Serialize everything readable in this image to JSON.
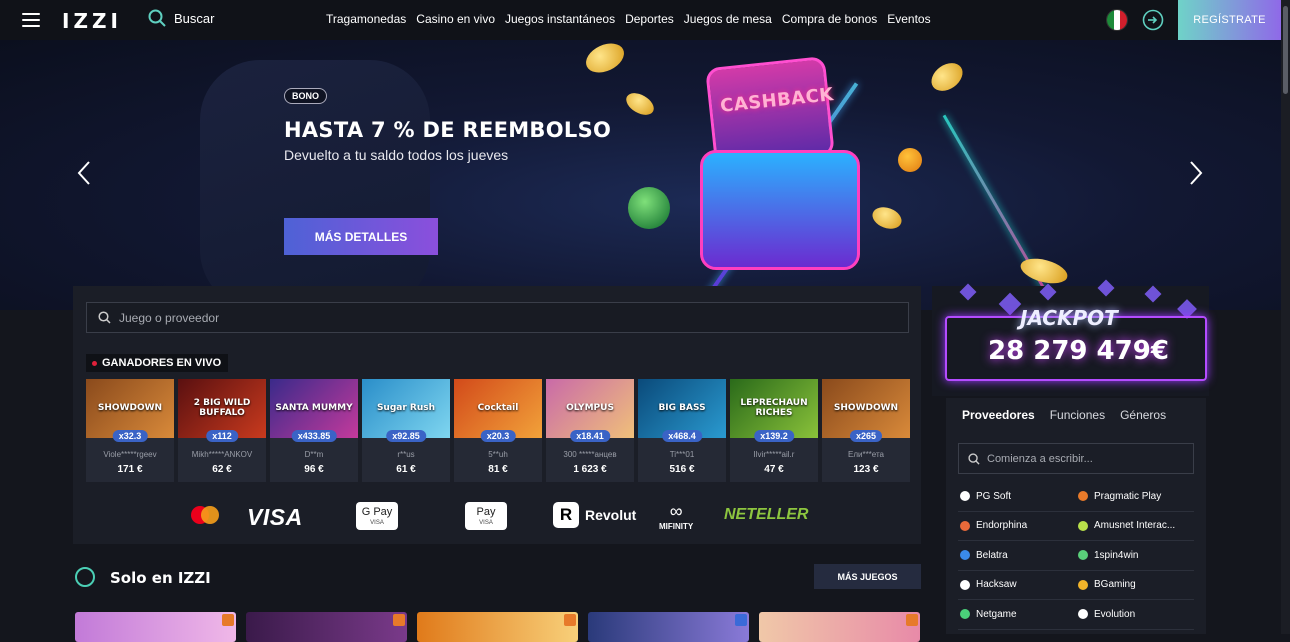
{
  "header": {
    "logo": "IZZI",
    "search_label": "Buscar",
    "nav": [
      "Tragamonedas",
      "Casino en vivo",
      "Juegos instantáneos",
      "Deportes",
      "Juegos de mesa",
      "Compra de bonos",
      "Eventos"
    ],
    "register_label": "REGÍSTRATE"
  },
  "hero": {
    "badge": "BONO",
    "title": "HASTA 7 % DE REEMBOLSO",
    "subtitle": "Devuelto a tu saldo todos los jueves",
    "button": "MÁS DETALLES",
    "art_text": "CASHBACK"
  },
  "game_search": {
    "placeholder": "Juego o proveedor"
  },
  "winners": {
    "label": "GANADORES EN VIVO",
    "items": [
      {
        "game": "SHOWDOWN",
        "multiplier": "x32.3",
        "user": "Viole*****rgeev",
        "amount": "171 €",
        "color1": "#8a4a1c",
        "color2": "#d98a3a"
      },
      {
        "game": "2 BIG WILD BUFFALO",
        "multiplier": "x112",
        "user": "Mikh*****ANKOV",
        "amount": "62 €",
        "color1": "#5a1010",
        "color2": "#c93a1e"
      },
      {
        "game": "SANTA MUMMY",
        "multiplier": "x433.85",
        "user": "D**m",
        "amount": "96 €",
        "color1": "#3a2a8a",
        "color2": "#c43a9c"
      },
      {
        "game": "Sugar Rush",
        "multiplier": "x92.85",
        "user": "r**us",
        "amount": "61 €",
        "color1": "#2a8ec9",
        "color2": "#7fd6f0"
      },
      {
        "game": "Cocktail",
        "multiplier": "x20.3",
        "user": "5**uh",
        "amount": "81 €",
        "color1": "#d24a1a",
        "color2": "#f2a23a"
      },
      {
        "game": "OLYMPUS",
        "multiplier": "x18.41",
        "user": "300 *****анцев",
        "amount": "1 623 €",
        "color1": "#c96aa8",
        "color2": "#f0c07a"
      },
      {
        "game": "BIG BASS",
        "multiplier": "x468.4",
        "user": "Ti***01",
        "amount": "516 €",
        "color1": "#0a4a7a",
        "color2": "#2a9ad0"
      },
      {
        "game": "LEPRECHAUN RICHES",
        "multiplier": "x139.2",
        "user": "Ilvir*****ail.r",
        "amount": "47 €",
        "color1": "#2a6a1a",
        "color2": "#8ac23a"
      },
      {
        "game": "SHOWDOWN",
        "multiplier": "x265",
        "user": "Ели***ета",
        "amount": "123 €",
        "color1": "#8a4a1c",
        "color2": "#d98a3a"
      }
    ]
  },
  "payments": {
    "visa": "VISA",
    "gpay": "G Pay",
    "gpay_sub": "VISA",
    "applepay": "Pay",
    "applepay_sub": "VISA",
    "revolut": "Revolut",
    "mifinity": "MIFINITY",
    "neteller": "NETELLER"
  },
  "solo": {
    "title": "Solo en IZZI",
    "button": "MÁS JUEGOS"
  },
  "jackpot": {
    "label": "JACKPOT",
    "value": "28 279 479€"
  },
  "providers": {
    "tabs": [
      "Proveedores",
      "Funciones",
      "Géneros"
    ],
    "search_placeholder": "Comienza a escribir...",
    "rows": [
      [
        "PG Soft",
        "Pragmatic Play"
      ],
      [
        "Endorphina",
        "Amusnet Interac..."
      ],
      [
        "Belatra",
        "1spin4win"
      ],
      [
        "Hacksaw",
        "BGaming"
      ],
      [
        "Netgame",
        "Evolution"
      ]
    ]
  },
  "colors": {
    "accent_teal": "#6fd3c8",
    "accent_purple": "#8f69e8",
    "multiplier_badge": "#3a63c6"
  }
}
